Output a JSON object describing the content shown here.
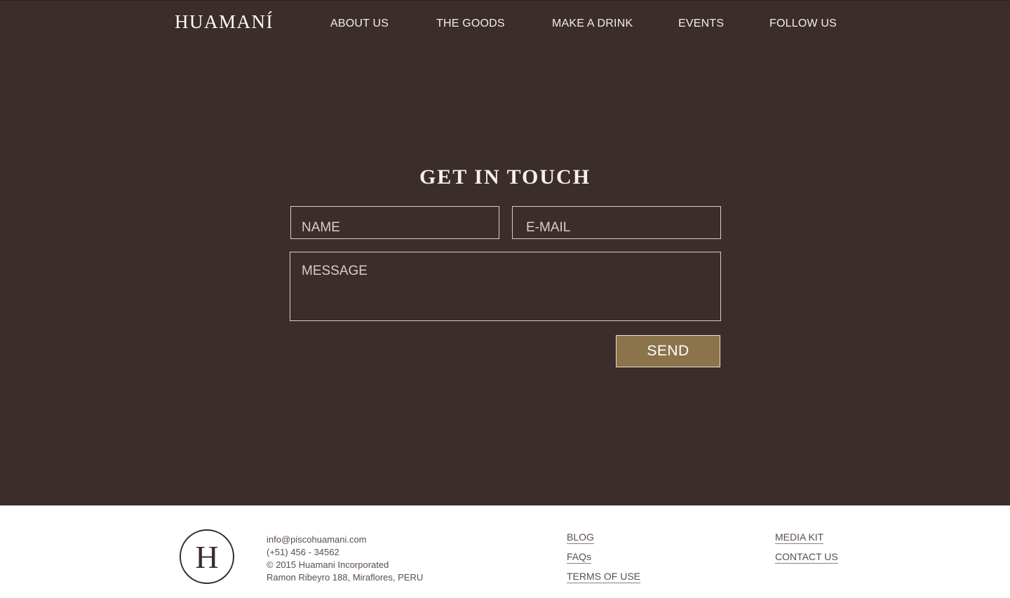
{
  "brand": {
    "logo_text": "HUAMANÍ"
  },
  "nav": {
    "items": [
      {
        "label": "ABOUT US"
      },
      {
        "label": "THE GOODS"
      },
      {
        "label": "MAKE A DRINK"
      },
      {
        "label": "EVENTS"
      },
      {
        "label": "FOLLOW US"
      }
    ]
  },
  "contact_form": {
    "heading": "GET IN TOUCH",
    "name_placeholder": "NAME",
    "email_placeholder": "E-MAIL",
    "message_placeholder": "MESSAGE",
    "send_label": "SEND"
  },
  "footer": {
    "emblem_letter": "H",
    "contact": {
      "email": "info@piscohuamani.com",
      "phone": "(+51) 456 - 34562",
      "copyright": "© 2015 Huamani Incorporated",
      "address": "Ramon Ribeyro 188, Miraflores, PERU"
    },
    "links_col1": [
      {
        "label": "BLOG"
      },
      {
        "label": "FAQs"
      },
      {
        "label": "TERMS OF USE"
      }
    ],
    "links_col2": [
      {
        "label": "MEDIA KIT"
      },
      {
        "label": "CONTACT US"
      }
    ]
  },
  "colors": {
    "background": "#3b2d29",
    "accent": "#8b734a",
    "footer_bg": "#ffffff",
    "field_border": "#d8cfc6"
  }
}
